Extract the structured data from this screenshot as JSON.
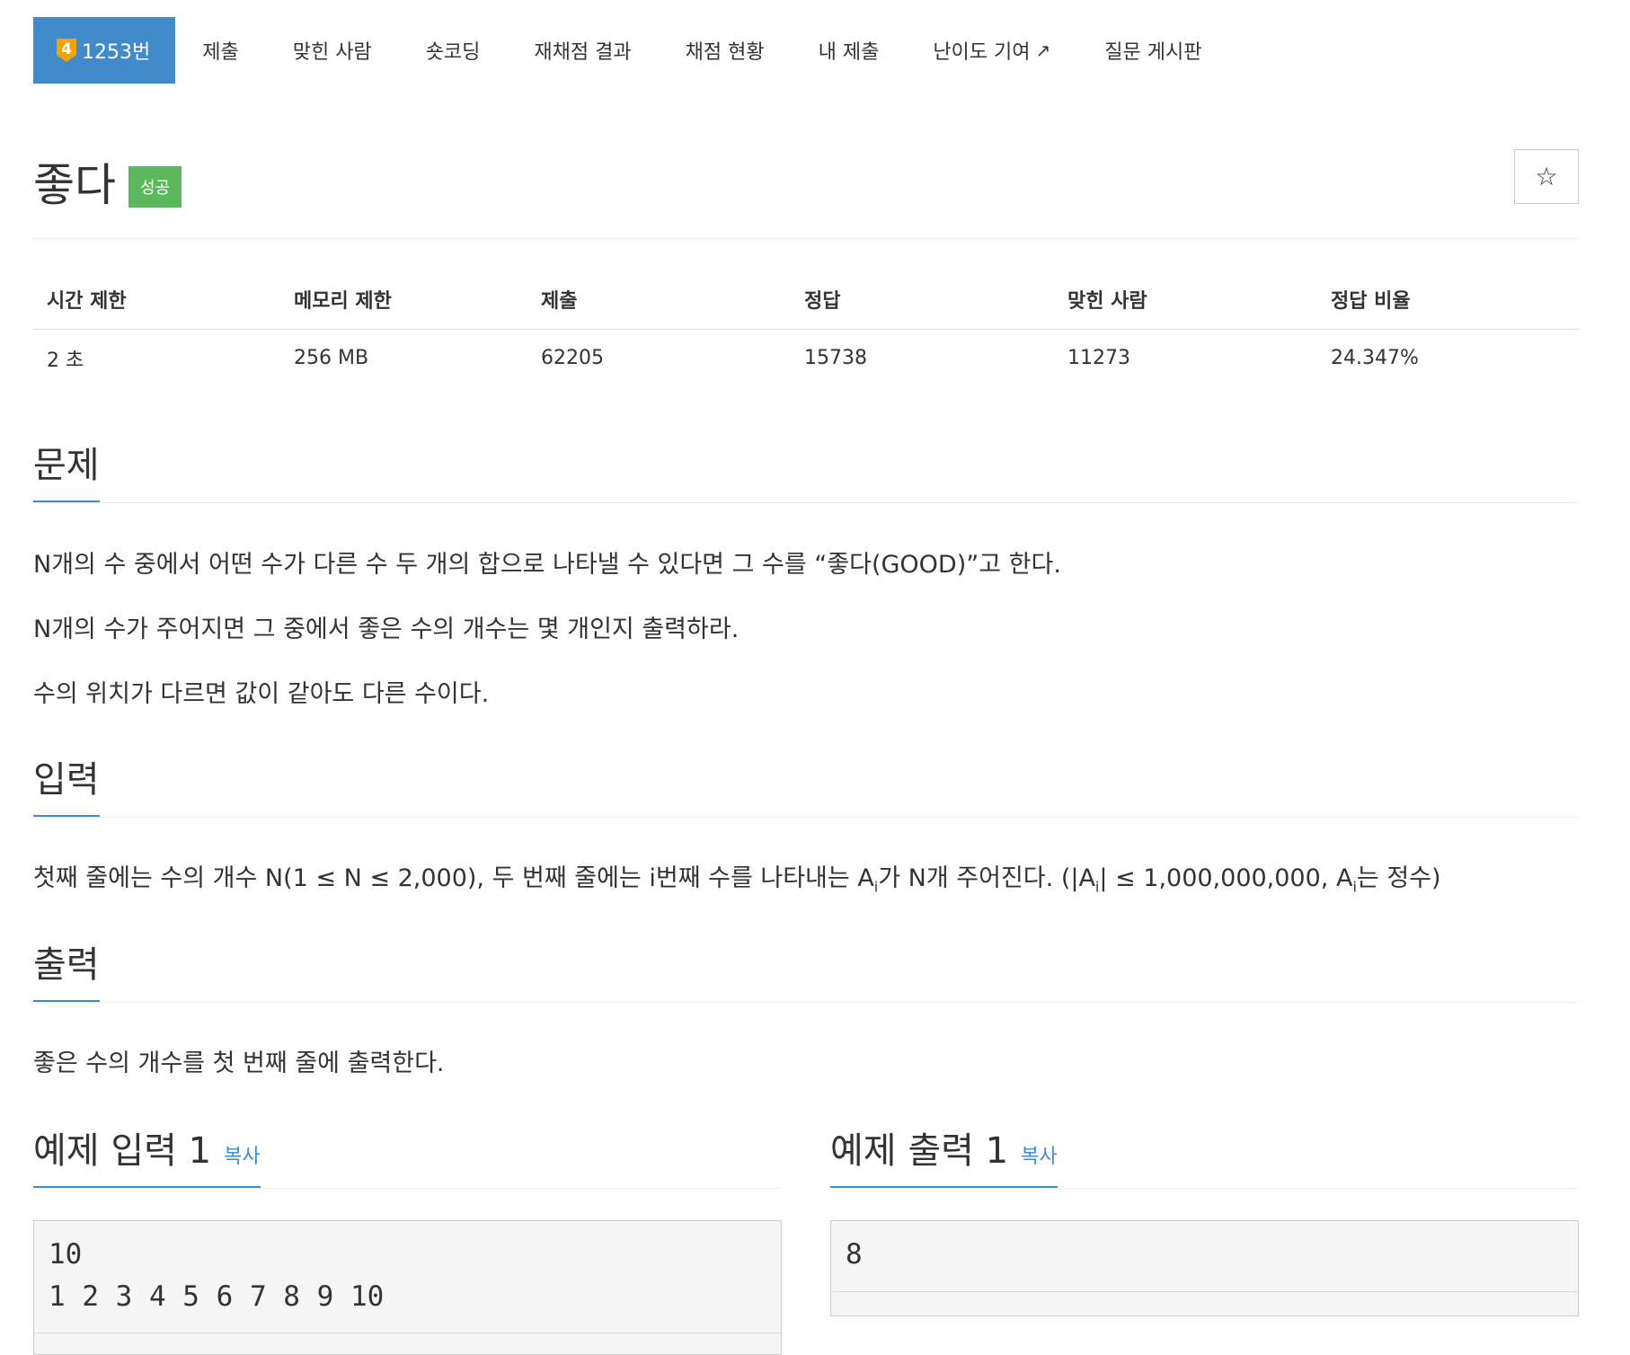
{
  "nav": {
    "tier": "4",
    "items": [
      {
        "label": "1253번"
      },
      {
        "label": "제출"
      },
      {
        "label": "맞힌 사람"
      },
      {
        "label": "숏코딩"
      },
      {
        "label": "재채점 결과"
      },
      {
        "label": "채점 현황"
      },
      {
        "label": "내 제출"
      },
      {
        "label": "난이도 기여"
      },
      {
        "label": "질문 게시판"
      }
    ],
    "ext_icon": "↗"
  },
  "problem": {
    "title": "좋다",
    "badge": "성공",
    "star_icon": "☆"
  },
  "stats": {
    "headers": [
      "시간 제한",
      "메모리 제한",
      "제출",
      "정답",
      "맞힌 사람",
      "정답 비율"
    ],
    "values": [
      "2 초",
      "256 MB",
      "62205",
      "15738",
      "11273",
      "24.347%"
    ]
  },
  "sections": {
    "problem_heading": "문제",
    "problem_lines": [
      "N개의 수 중에서 어떤 수가 다른 수 두 개의 합으로 나타낼 수 있다면 그 수를 “좋다(GOOD)”고 한다.",
      "N개의 수가 주어지면 그 중에서 좋은 수의 개수는 몇 개인지 출력하라.",
      "수의 위치가 다르면 값이 같아도 다른 수이다."
    ],
    "input_heading": "입력",
    "input_text": {
      "p1": "첫째 줄에는 수의 개수 N(1 ≤ N ≤ 2,000), 두 번째 줄에는 i번째 수를 나타내는 A",
      "sub1": "i",
      "p2": "가 N개 주어진다. (|A",
      "sub2": "i",
      "p3": "| ≤ 1,000,000,000, A",
      "sub3": "i",
      "p4": "는 정수)"
    },
    "output_heading": "출력",
    "output_text": "좋은 수의 개수를 첫 번째 줄에 출력한다."
  },
  "samples": {
    "input_heading": "예제 입력 1",
    "output_heading": "예제 출력 1",
    "copy_label": "복사",
    "input_lines": [
      "10",
      "1 2 3 4 5 6 7 8 9 10"
    ],
    "output_lines": [
      "8"
    ]
  }
}
